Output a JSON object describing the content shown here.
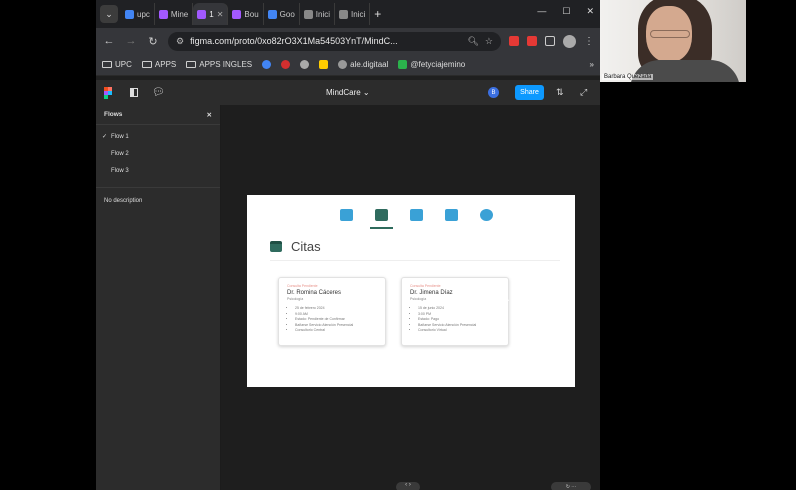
{
  "browser": {
    "tabs": [
      {
        "label": "upc",
        "color": "#4285f4"
      },
      {
        "label": "Mine",
        "color": "#a259ff"
      },
      {
        "label": "1",
        "color": "#a259ff",
        "active": true
      },
      {
        "label": "Bou",
        "color": "#a259ff"
      },
      {
        "label": "Goo",
        "color": "#4285f4"
      },
      {
        "label": "Inici",
        "color": "#888888"
      },
      {
        "label": "Inici",
        "color": "#888888"
      }
    ],
    "url": "figma.com/proto/0xo82rO3X1Ma54503YnT/MindC...",
    "bookmarks": [
      {
        "label": "UPC",
        "icon": "folder-icon"
      },
      {
        "label": "APPS",
        "icon": "folder-icon"
      },
      {
        "label": "APPS INGLES",
        "icon": "folder-icon"
      },
      {
        "label": "ale.digitaal",
        "icon": "globe-icon"
      },
      {
        "label": "@fetyciajemino",
        "icon": "green-icon"
      }
    ]
  },
  "figma": {
    "file_name": "MindCare",
    "share_label": "Share",
    "user_initial": "B",
    "flows_panel": {
      "title": "Flows",
      "items": [
        "Flow 1",
        "Flow 2",
        "Flow 3"
      ],
      "selected": "Flow 1",
      "description": "No description"
    }
  },
  "prototype": {
    "nav_icons": [
      {
        "name": "snowflake-icon",
        "color": "#3aa1d6"
      },
      {
        "name": "calendar-icon",
        "color": "#2f6b5e",
        "active": true
      },
      {
        "name": "video-icon",
        "color": "#3aa1d6"
      },
      {
        "name": "document-icon",
        "color": "#3aa1d6"
      },
      {
        "name": "settings-icon",
        "color": "#3aa1d6"
      }
    ],
    "page_title": "Citas",
    "cards": [
      {
        "status": "Consulta Pendiente",
        "doctor": "Dr. Romina Cáceres",
        "specialty": "Psicología",
        "details": [
          "25 de febrero 2024",
          "9:00 AM",
          "Estado: Pendiente de Confirmar",
          "Bañarse Servicio Atención Presencial",
          "Consultorio Central"
        ]
      },
      {
        "status": "Consulta Pendiente",
        "doctor": "Dr. Jimena Díaz",
        "specialty": "Psicología",
        "details": [
          "15 de junio 2024",
          "3:00 PM",
          "Estado: Pago",
          "Bañarse Servicio Atención Presencial",
          "Consultorio Virtual"
        ]
      }
    ]
  },
  "webcam": {
    "participant_name": "Barbara Quezada"
  }
}
